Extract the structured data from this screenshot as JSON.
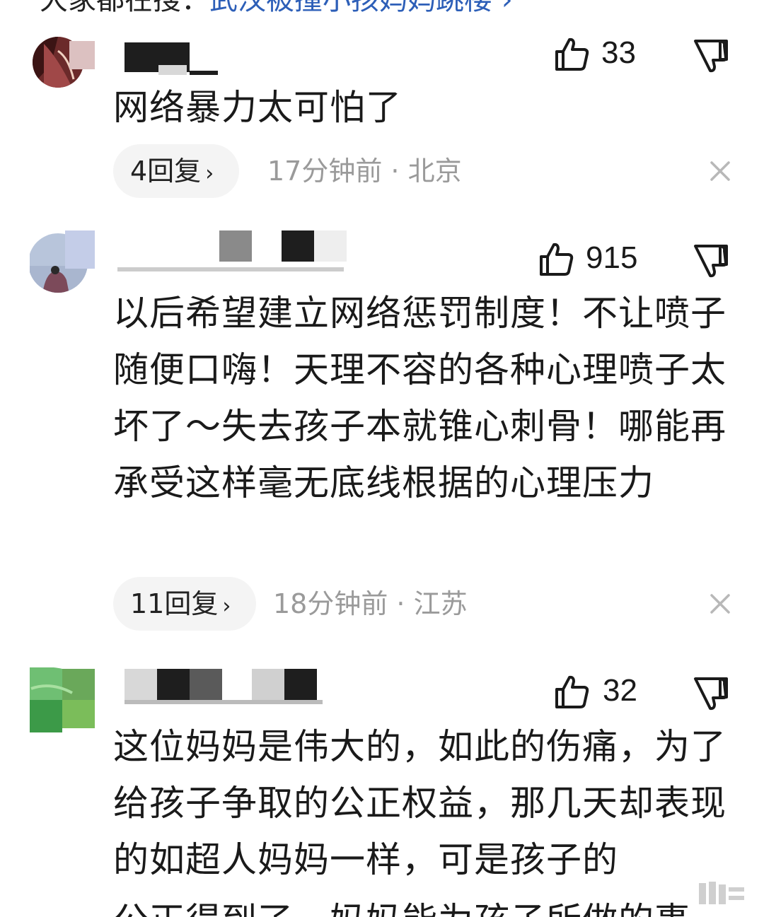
{
  "top_banner": {
    "prefix": "大家都在搜：",
    "link": "武汉被撞小孩妈妈跳楼 ›"
  },
  "comments": [
    {
      "username": "",
      "like_count": "33",
      "text": "网络暴力太可怕了",
      "reply_label": "4回复",
      "time_location": "17分钟前 · 北京"
    },
    {
      "username": "",
      "like_count": "915",
      "text": "以后希望建立网络惩罚制度！不让喷子随便口嗨！天理不容的各种心理喷子太坏了～失去孩子本就锥心刺骨！哪能再承受这样毫无底线根据的心理压力",
      "reply_label": "11回复",
      "time_location": "18分钟前 · 江苏"
    },
    {
      "username": "",
      "like_count": "32",
      "text": "这位妈妈是伟大的，如此的伤痛，为了给孩子争取的公正权益，那几天却表现的如超人妈妈一样，可是孩子的"
    }
  ],
  "bottom_cut_text": "公正得到了，妈妈能为孩子所做的事",
  "icons": {
    "like": "thumb-up-icon",
    "dislike": "thumb-down-icon",
    "dismiss": "close-icon",
    "reply_chevron": "chevron-right-icon"
  },
  "colors": {
    "link": "#2d5fb8",
    "meta_gray": "#9a9a9a",
    "pill_bg": "#f4f4f4"
  }
}
